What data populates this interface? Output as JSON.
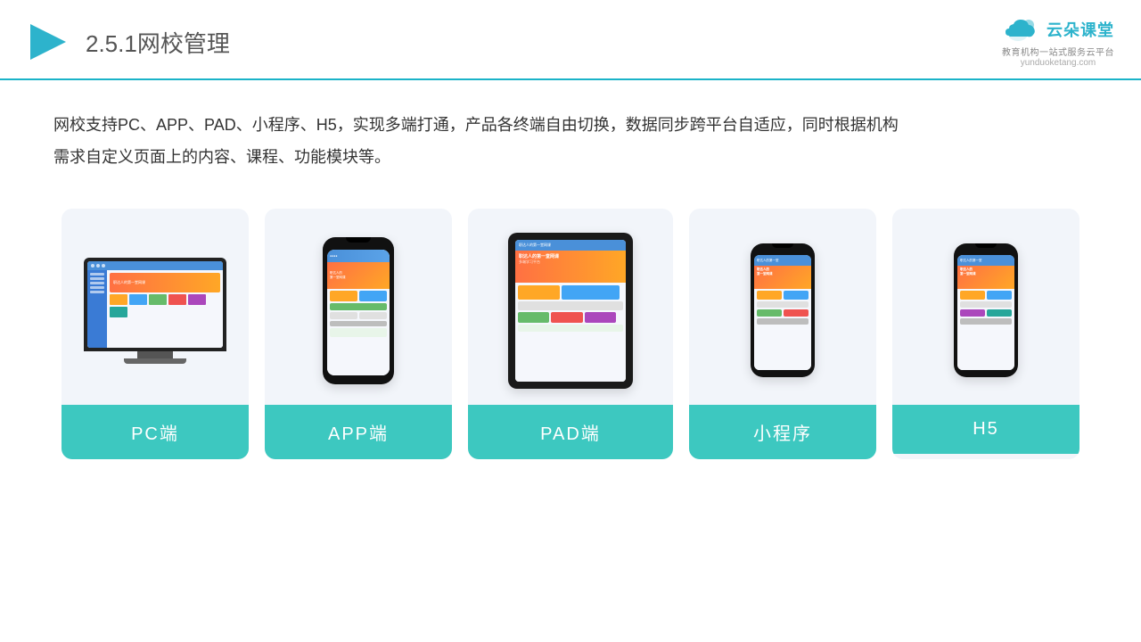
{
  "header": {
    "title_prefix": "2.5.1",
    "title_main": "网校管理",
    "logo_main": "云朵课堂",
    "logo_domain": "yunduoketang.com",
    "logo_tagline": "教育机构一站式服务云平台"
  },
  "description": {
    "text1": "网校支持PC、APP、PAD、小程序、H5，实现多端打通，产品各终端自由切换，数据同步跨平台自适应，同时根据机构",
    "text2": "需求自定义页面上的内容、课程、功能模块等。"
  },
  "cards": [
    {
      "label": "PC端",
      "type": "pc"
    },
    {
      "label": "APP端",
      "type": "phone"
    },
    {
      "label": "PAD端",
      "type": "tablet"
    },
    {
      "label": "小程序",
      "type": "phone_mini"
    },
    {
      "label": "H5",
      "type": "phone_mini2"
    }
  ]
}
